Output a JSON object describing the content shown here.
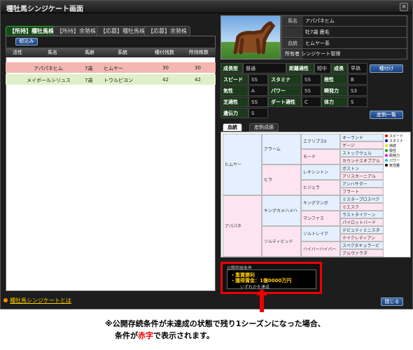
{
  "window": {
    "title": "種牡馬シンジケート画面",
    "close_glyph": "×"
  },
  "tabs": [
    "【所持】種牡馬株",
    "【所持】余勢株",
    "【応募】種牡馬株",
    "【応募】余勢株"
  ],
  "filter_button": "絞込み",
  "table": {
    "headers": [
      "活性",
      "馬名",
      "馬齢",
      "系統",
      "種付残数",
      "所持株数"
    ],
    "rows": [
      [
        "",
        "アパパネヒム",
        "7歳",
        "ヒムヤー",
        "30",
        "30"
      ],
      [
        "",
        "メイボールシリュス",
        "7歳",
        "トウルビヨン",
        "42",
        "42"
      ]
    ]
  },
  "footer_link": "種牡馬シンジケートとは",
  "horse": {
    "rows": [
      {
        "k": "馬名",
        "v": "アパパネヒム"
      },
      {
        "k": "",
        "v": "牡7歳 鹿毛"
      },
      {
        "k": "血統",
        "v": "ヒムヤー系"
      },
      {
        "k": "",
        "v": "所有者  シンジケート管理"
      }
    ]
  },
  "stats": {
    "row0": [
      {
        "k": "成長型",
        "v": "普通"
      },
      {
        "k": "距離適性",
        "v": "短中"
      },
      {
        "k": "成長",
        "v": "早熟"
      }
    ],
    "rows": [
      [
        {
          "k": "スピード",
          "v": "SS"
        },
        {
          "k": "スタミナ",
          "v": "SS"
        },
        {
          "k": "根性",
          "v": "B"
        }
      ],
      [
        {
          "k": "気性",
          "v": "A"
        },
        {
          "k": "パワー",
          "v": "SS"
        },
        {
          "k": "瞬発力",
          "v": "S3"
        }
      ],
      [
        {
          "k": "芝適性",
          "v": "SS"
        },
        {
          "k": "ダート適性",
          "v": "C"
        },
        {
          "k": "体力",
          "v": "S"
        }
      ],
      [
        {
          "k": "遺伝力",
          "v": "S"
        }
      ]
    ]
  },
  "buttons": {
    "stud": "種付け",
    "progeny": "産駒一覧",
    "close": "閉じる"
  },
  "ped_tabs": [
    "血統",
    "産駒成績"
  ],
  "pedigree": {
    "sire": "ヒムヤー",
    "dam": "アパパネ",
    "g2": [
      "アラーム",
      "ヒラ",
      "キングカメハメハ",
      "ソルティビッド"
    ],
    "g3": [
      "エクリプスII",
      "モード",
      "レキシントン",
      "ヒジュラ",
      "キングマンボ",
      "マンファス",
      "ソルトレイク",
      "ハイバーハイバー"
    ],
    "g4": [
      "オーランド",
      "ゲージ",
      "ストックウェル",
      "カウンテスオブアル",
      "ボストン",
      "アリスカーニアル",
      "アンハサダー",
      "フラート",
      "ミスタープロスペク",
      "ミエスク",
      "ラストタイクーン",
      "パイロットバード",
      "デピュティミニスタ",
      "テイクレディアン",
      "スペクタキュラービ",
      "アルヴァラダ"
    ]
  },
  "legend": [
    {
      "label": "スピード",
      "color": "#e00"
    },
    {
      "label": "スタミナ",
      "color": "#00c"
    },
    {
      "label": "持続",
      "color": "#dd0"
    },
    {
      "label": "根性",
      "color": "#0a0"
    },
    {
      "label": "瞬発力",
      "color": "#f0f"
    },
    {
      "label": "パワー",
      "color": "#0cf"
    },
    {
      "label": "気性難",
      "color": "#000"
    }
  ],
  "condition": {
    "title": "公開存続条件",
    "lines": [
      "・重賞勝利",
      "・獲得賞金：1億0000万円"
    ],
    "sub": "いずれかを達成"
  },
  "note": {
    "line1": "※公開存続条件が未達成の状態で残り1シーズンになった場合、",
    "line2_pre": "条件が",
    "line2_red": "赤字",
    "line2_post": "で表示されます。"
  }
}
